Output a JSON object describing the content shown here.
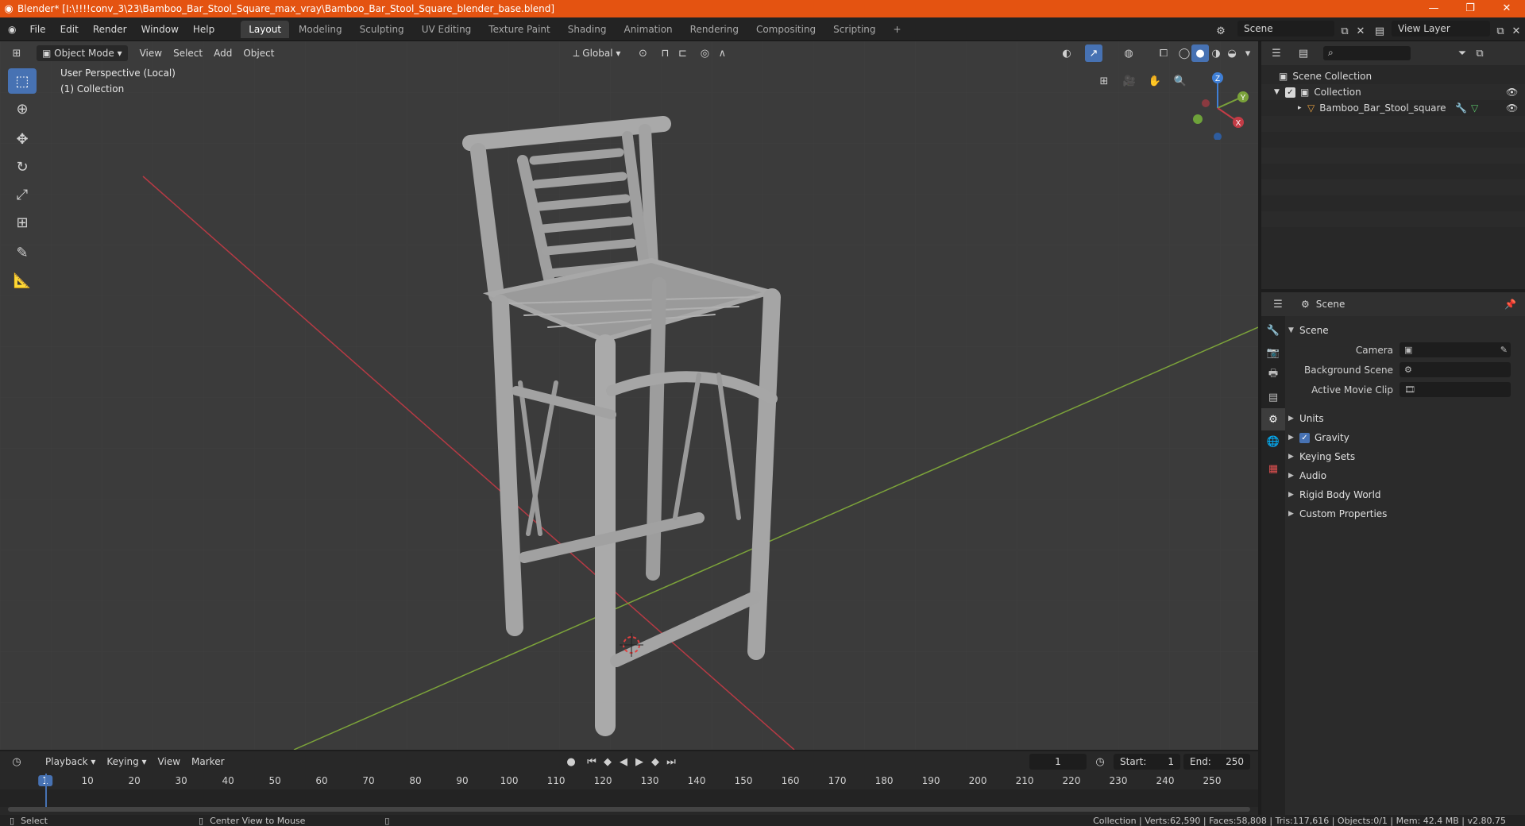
{
  "window": {
    "title": "Blender* [I:\\!!!!conv_3\\23\\Bamboo_Bar_Stool_Square_max_vray\\Bamboo_Bar_Stool_Square_blender_base.blend]"
  },
  "menu": {
    "items": [
      "File",
      "Edit",
      "Render",
      "Window",
      "Help"
    ],
    "workspaces": [
      "Layout",
      "Modeling",
      "Sculpting",
      "UV Editing",
      "Texture Paint",
      "Shading",
      "Animation",
      "Rendering",
      "Compositing",
      "Scripting"
    ],
    "active_workspace": "Layout",
    "scene_field": "Scene",
    "view_layer_field": "View Layer"
  },
  "viewport": {
    "mode": "Object Mode",
    "menus": [
      "View",
      "Select",
      "Add",
      "Object"
    ],
    "transform_orientation": "Global",
    "perspective_label": "User Perspective (Local)",
    "collection_label": "(1) Collection",
    "gizmo_axes": {
      "x": "X",
      "y": "Y",
      "z": "Z"
    }
  },
  "outliner": {
    "root": "Scene Collection",
    "collection": "Collection",
    "object": "Bamboo_Bar_Stool_square"
  },
  "properties": {
    "header": "Scene",
    "panel": "Scene",
    "fields": [
      {
        "label": "Camera",
        "value": ""
      },
      {
        "label": "Background Scene",
        "value": ""
      },
      {
        "label": "Active Movie Clip",
        "value": ""
      }
    ],
    "subpanels": [
      "Units",
      "Gravity",
      "Keying Sets",
      "Audio",
      "Rigid Body World",
      "Custom Properties"
    ],
    "gravity_enabled": true
  },
  "timeline": {
    "menus": [
      "Playback",
      "Keying",
      "View",
      "Marker"
    ],
    "current_frame": "1",
    "start_label": "Start:",
    "start": "1",
    "end_label": "End:",
    "end": "250",
    "ticks": [
      "1",
      "10",
      "20",
      "30",
      "40",
      "50",
      "60",
      "70",
      "80",
      "90",
      "100",
      "110",
      "120",
      "130",
      "140",
      "150",
      "160",
      "170",
      "180",
      "190",
      "200",
      "210",
      "220",
      "230",
      "240",
      "250"
    ]
  },
  "statusbar": {
    "left_action": "Select",
    "middle_action": "Center View to Mouse",
    "stats": "Collection | Verts:62,590 | Faces:58,808 | Tris:117,616 | Objects:0/1 | Mem: 42.4 MB | v2.80.75"
  },
  "colors": {
    "title_bar": "#e45311",
    "accent": "#4772b3",
    "viewport_bg": "#3b3b3b",
    "x_axis": "#c33c46",
    "y_axis": "#7aa23a",
    "z_axis": "#3f7fd6"
  }
}
